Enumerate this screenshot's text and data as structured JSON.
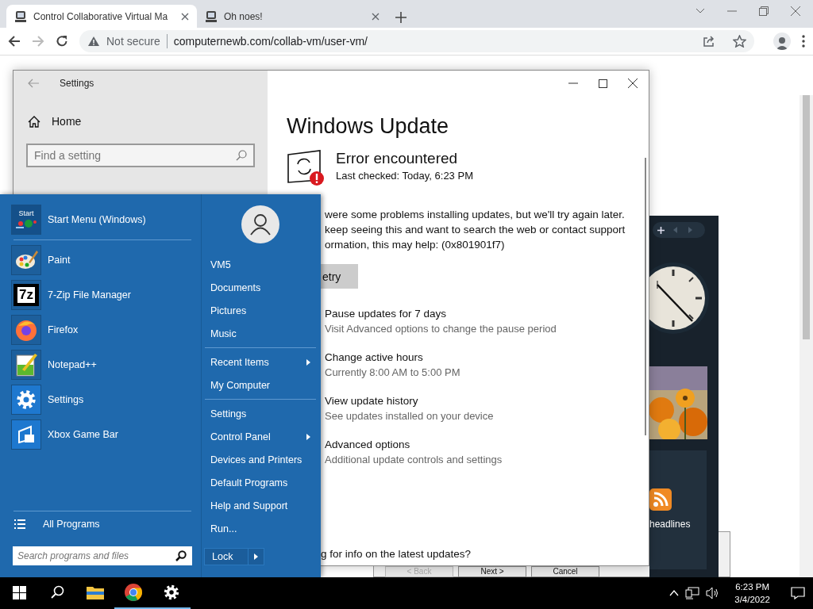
{
  "browser": {
    "tabs": [
      {
        "title": "Control Collaborative Virtual Ma",
        "selected": true
      },
      {
        "title": "Oh noes!",
        "selected": false
      }
    ],
    "security_label": "Not secure",
    "url": "computernewb.com/collab-vm/user-vm/"
  },
  "settings_window": {
    "title": "Settings",
    "home_label": "Home",
    "search_placeholder": "Find a setting",
    "heading": "Windows Update",
    "status_title": "Error encountered",
    "last_checked": "Last checked: Today, 6:23 PM",
    "message_lines": [
      "were some problems installing updates, but we'll try again later.",
      "keep seeing this and want to search the web or contact support",
      "ormation, this may help: (0x801901f7)"
    ],
    "retry_label": "etry",
    "options": [
      {
        "title": "Pause updates for 7 days",
        "subtitle": "Visit Advanced options to change the pause period"
      },
      {
        "title": "Change active hours",
        "subtitle": "Currently 8:00 AM to 5:00 PM"
      },
      {
        "title": "View update history",
        "subtitle": "See updates installed on your device"
      },
      {
        "title": "Advanced options",
        "subtitle": "Additional update controls and settings"
      }
    ],
    "footer_question": "g for info on the latest updates?"
  },
  "wizard_buttons": [
    {
      "label": "< Back",
      "disabled": true
    },
    {
      "label": "Next >",
      "disabled": false
    },
    {
      "label": "Cancel",
      "disabled": false
    }
  ],
  "gadgets": {
    "headlines_label": "headlines"
  },
  "start_menu": {
    "programs": [
      {
        "name": "Start Menu (Windows)",
        "kind": "start",
        "icon_text": "Start"
      },
      {
        "name": "Paint",
        "kind": "paint"
      },
      {
        "name": "7-Zip File Manager",
        "kind": "archiver",
        "icon_text": "7z"
      },
      {
        "name": "Firefox",
        "kind": "browser"
      },
      {
        "name": "Notepad++",
        "kind": "editor"
      },
      {
        "name": "Settings",
        "kind": "settings"
      },
      {
        "name": "Xbox Game Bar",
        "kind": "gamebar"
      }
    ],
    "all_programs": "All Programs",
    "search_placeholder": "Search programs and files",
    "link_groups": [
      [
        {
          "label": "VM5",
          "submenu": false
        },
        {
          "label": "Documents",
          "submenu": false
        },
        {
          "label": "Pictures",
          "submenu": false
        },
        {
          "label": "Music",
          "submenu": false
        }
      ],
      [
        {
          "label": "Recent Items",
          "submenu": true
        },
        {
          "label": "My Computer",
          "submenu": false
        }
      ],
      [
        {
          "label": "Settings",
          "submenu": false
        },
        {
          "label": "Control Panel",
          "submenu": true
        },
        {
          "label": "Devices and Printers",
          "submenu": false
        },
        {
          "label": "Default Programs",
          "submenu": false
        },
        {
          "label": "Help and Support",
          "submenu": false
        },
        {
          "label": "Run...",
          "submenu": false
        }
      ]
    ],
    "lock_label": "Lock"
  },
  "taskbar": {
    "apps": [
      {
        "kind": "start",
        "running": false
      },
      {
        "kind": "search",
        "running": false
      },
      {
        "kind": "explorer",
        "running": false
      },
      {
        "kind": "chrome",
        "running": true
      },
      {
        "kind": "settings",
        "running": true
      }
    ],
    "time": "6:23 PM",
    "date": "3/4/2022"
  }
}
